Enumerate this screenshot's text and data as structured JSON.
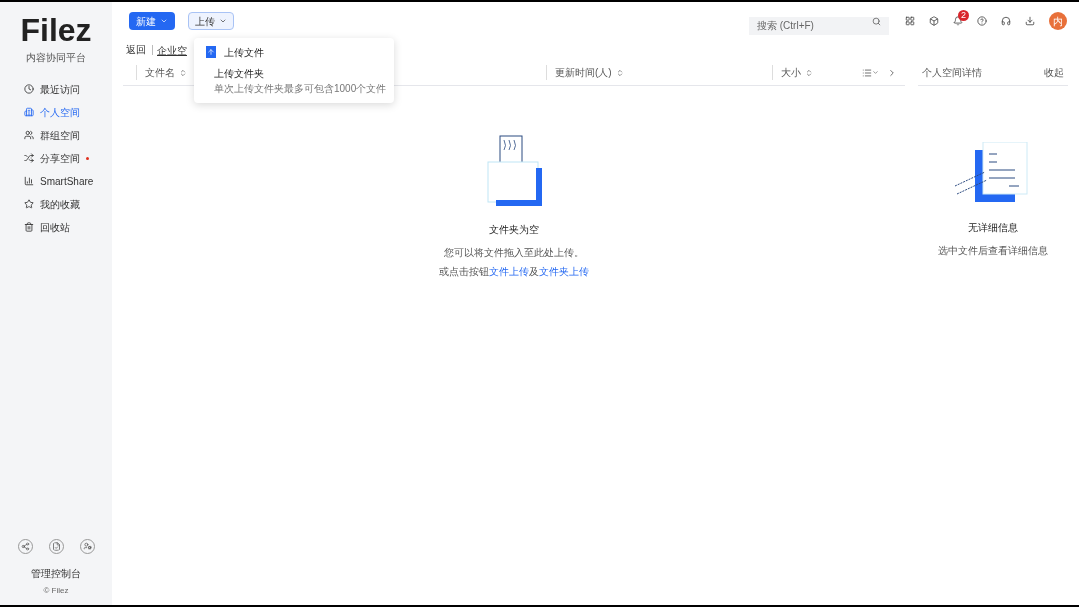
{
  "logo": {
    "name": "Filez",
    "subtitle": "内容协同平台"
  },
  "nav": [
    {
      "label": "最近访问",
      "selected": false,
      "dot": false
    },
    {
      "label": "个人空间",
      "selected": true,
      "dot": false
    },
    {
      "label": "群组空间",
      "selected": false,
      "dot": false
    },
    {
      "label": "分享空间",
      "selected": false,
      "dot": true
    },
    {
      "label": "SmartShare",
      "selected": false,
      "dot": false
    },
    {
      "label": "我的收藏",
      "selected": false,
      "dot": false
    },
    {
      "label": "回收站",
      "selected": false,
      "dot": false
    }
  ],
  "sidebar_footer": {
    "console": "管理控制台",
    "copyright": "© Filez"
  },
  "toolbar": {
    "new_button": "新建",
    "upload_button": "上传"
  },
  "upload_menu": [
    {
      "label": "上传文件",
      "kind": "file"
    },
    {
      "label": "上传文件夹",
      "kind": "folder",
      "hint": "单次上传文件夹最多可包含1000个文件"
    }
  ],
  "search": {
    "placeholder": "搜索 (Ctrl+F)"
  },
  "notifications": {
    "count": "2"
  },
  "avatar": "内",
  "breadcrumb": {
    "back": "返回",
    "path": "企业空"
  },
  "columns": [
    "文件名",
    "更新时间(人)",
    "大小"
  ],
  "empty": {
    "title": "文件夹为空",
    "line1": "您可以将文件拖入至此处上传。",
    "line2_prefix": "或点击按钮",
    "link1": "文件上传",
    "line2_mid": "及",
    "link2": "文件夹上传"
  },
  "details": {
    "title": "个人空间详情",
    "action": "收起",
    "empty_title": "无详细信息",
    "empty_hint": "选中文件后查看详细信息"
  }
}
